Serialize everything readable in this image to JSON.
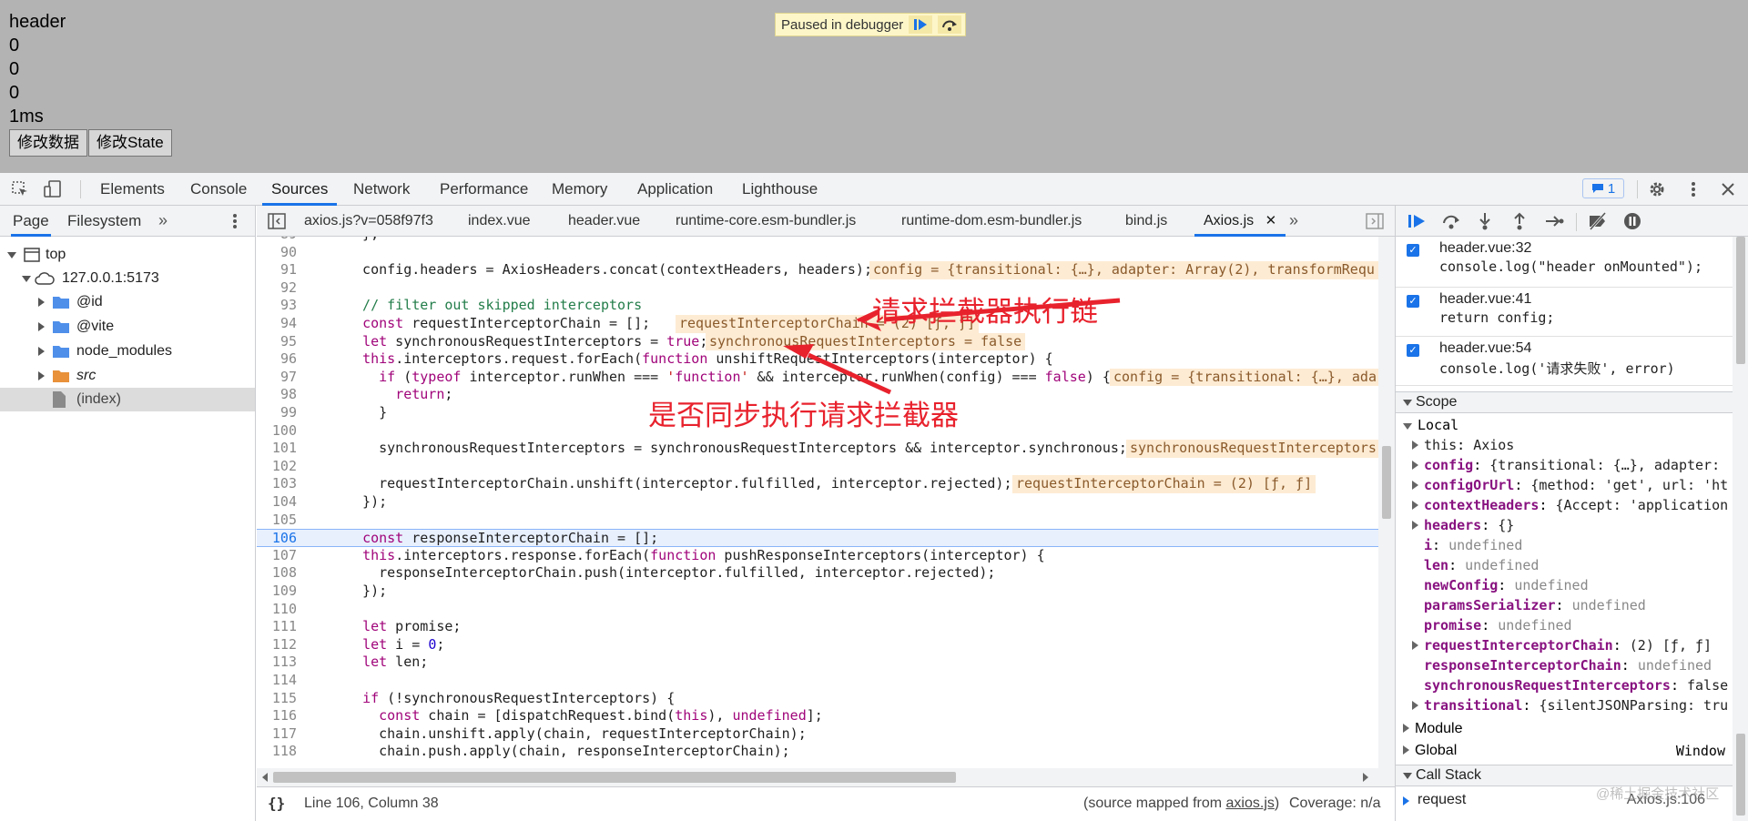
{
  "page": {
    "lines": [
      "header",
      "0",
      "0",
      "0",
      "1ms"
    ],
    "buttons": [
      "修改数据",
      "修改State"
    ],
    "paused_label": "Paused in debugger"
  },
  "devtools": {
    "top_tabs": [
      "Elements",
      "Console",
      "Sources",
      "Network",
      "Performance",
      "Memory",
      "Application",
      "Lighthouse"
    ],
    "active_tab": "Sources",
    "issues_count": "1"
  },
  "navigator": {
    "tabs": [
      "Page",
      "Filesystem"
    ],
    "tree": [
      {
        "label": "top"
      },
      {
        "label": "127.0.0.1:5173"
      },
      {
        "label": "@id"
      },
      {
        "label": "@vite"
      },
      {
        "label": "node_modules"
      },
      {
        "label": "src"
      },
      {
        "label": "(index)"
      }
    ]
  },
  "editor": {
    "file_tabs": [
      "axios.js?v=058f97f3",
      "index.vue",
      "header.vue",
      "runtime-core.esm-bundler.js",
      "runtime-dom.esm-bundler.js",
      "bind.js",
      "Axios.js"
    ],
    "active_file": "Axios.js",
    "lines": [
      {
        "n": "89",
        "code": "  };"
      },
      {
        "n": "90",
        "code": ""
      },
      {
        "n": "91",
        "code": "  config.headers = AxiosHeaders.concat(contextHeaders, headers);",
        "val": "config = {transitional: {…}, adapter: Array(2), transformRequ"
      },
      {
        "n": "92",
        "code": ""
      },
      {
        "n": "93",
        "code": "  // filter out skipped interceptors"
      },
      {
        "n": "94",
        "code": "  const requestInterceptorChain = [];",
        "val": "requestInterceptorChain = (2) [ƒ, ƒ]"
      },
      {
        "n": "95",
        "code": "  let synchronousRequestInterceptors = true;",
        "val": "synchronousRequestInterceptors = false"
      },
      {
        "n": "96",
        "code": "  this.interceptors.request.forEach(function unshiftRequestInterceptors(interceptor) {"
      },
      {
        "n": "97",
        "code": "    if (typeof interceptor.runWhen === 'function' && interceptor.runWhen(config) === false) {",
        "val": "config = {transitional: {…}, ada"
      },
      {
        "n": "98",
        "code": "      return;"
      },
      {
        "n": "99",
        "code": "    }"
      },
      {
        "n": "100",
        "code": ""
      },
      {
        "n": "101",
        "code": "    synchronousRequestInterceptors = synchronousRequestInterceptors && interceptor.synchronous;",
        "val": "synchronousRequestInterceptors"
      },
      {
        "n": "102",
        "code": ""
      },
      {
        "n": "103",
        "code": "    requestInterceptorChain.unshift(interceptor.fulfilled, interceptor.rejected);",
        "val": "requestInterceptorChain = (2) [ƒ, ƒ]"
      },
      {
        "n": "104",
        "code": "  });"
      },
      {
        "n": "105",
        "code": ""
      },
      {
        "n": "106",
        "code": "  const responseInterceptorChain = [];",
        "current": true
      },
      {
        "n": "107",
        "code": "  this.interceptors.response.forEach(function pushResponseInterceptors(interceptor) {"
      },
      {
        "n": "108",
        "code": "    responseInterceptorChain.push(interceptor.fulfilled, interceptor.rejected);"
      },
      {
        "n": "109",
        "code": "  });"
      },
      {
        "n": "110",
        "code": ""
      },
      {
        "n": "111",
        "code": "  let promise;"
      },
      {
        "n": "112",
        "code": "  let i = 0;"
      },
      {
        "n": "113",
        "code": "  let len;"
      },
      {
        "n": "114",
        "code": ""
      },
      {
        "n": "115",
        "code": "  if (!synchronousRequestInterceptors) {"
      },
      {
        "n": "116",
        "code": "    const chain = [dispatchRequest.bind(this), undefined];"
      },
      {
        "n": "117",
        "code": "    chain.unshift.apply(chain, requestInterceptorChain);"
      },
      {
        "n": "118",
        "code": "    chain.push.apply(chain, responseInterceptorChain);"
      }
    ],
    "status_position": "Line 106, Column 38",
    "status_source_prefix": "(source mapped from ",
    "status_source_file": "axios.js",
    "status_source_suffix": ")",
    "status_coverage": "Coverage: n/a"
  },
  "annotations": {
    "chain_label": "请求拦截器执行链",
    "sync_label": "是否同步执行请求拦截器",
    "color": "#e8222d"
  },
  "sidebar": {
    "breakpoints": [
      {
        "loc": "header.vue:32",
        "code": "console.log(\"header onMounted\");"
      },
      {
        "loc": "header.vue:41",
        "code": "return config;"
      },
      {
        "loc": "header.vue:54",
        "code": "console.log('请求失败', error)"
      }
    ],
    "scope_title": "Scope",
    "local_title": "Local",
    "scope_items": [
      {
        "key": "this",
        "value": "Axios",
        "expand": true,
        "plain": true
      },
      {
        "key": "config",
        "value": "{transitional: {…}, adapter:",
        "expand": true
      },
      {
        "key": "configOrUrl",
        "value": "{method: 'get', url: 'ht",
        "expand": true
      },
      {
        "key": "contextHeaders",
        "value": "{Accept: 'application",
        "expand": true
      },
      {
        "key": "headers",
        "value": "{}",
        "expand": true
      },
      {
        "key": "i",
        "value": "undefined"
      },
      {
        "key": "len",
        "value": "undefined"
      },
      {
        "key": "newConfig",
        "value": "undefined"
      },
      {
        "key": "paramsSerializer",
        "value": "undefined"
      },
      {
        "key": "promise",
        "value": "undefined"
      },
      {
        "key": "requestInterceptorChain",
        "value": "(2) [ƒ, ƒ]",
        "expand": true
      },
      {
        "key": "responseInterceptorChain",
        "value": "undefined"
      },
      {
        "key": "synchronousRequestInterceptors",
        "value": "false"
      },
      {
        "key": "transitional",
        "value": "{silentJSONParsing: tru",
        "expand": true
      }
    ],
    "module_title": "Module",
    "global_title": "Global",
    "global_value": "Window",
    "callstack_title": "Call Stack",
    "callstack_fn": "request",
    "callstack_loc": "Axios.js:106",
    "watermark": "@稀土掘金技术社区"
  }
}
